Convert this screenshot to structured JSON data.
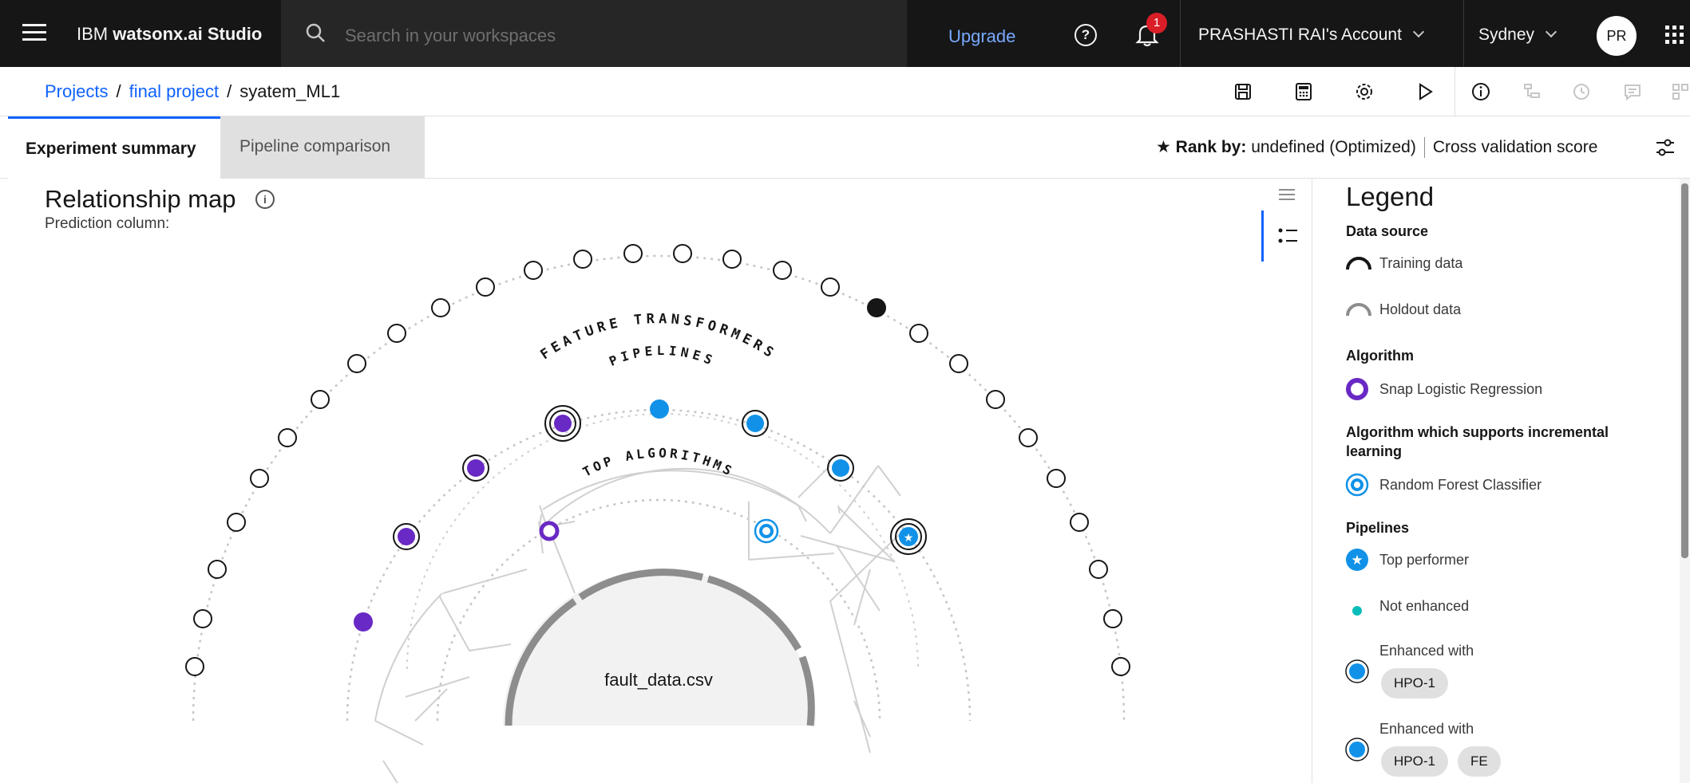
{
  "header": {
    "brand_prefix": "IBM",
    "brand_name": "watsonx.ai Studio",
    "search_placeholder": "Search in your workspaces",
    "upgrade": "Upgrade",
    "notification_count": "1",
    "account": "PRASHASTI RAI's Account",
    "region": "Sydney",
    "avatar_initials": "PR"
  },
  "breadcrumb": {
    "projects": "Projects",
    "project": "final project",
    "current": "syatem_ML1",
    "separator": "/"
  },
  "tabs": {
    "summary": "Experiment summary",
    "comparison": "Pipeline comparison"
  },
  "rank": {
    "label": "Rank by:",
    "value": "undefined (Optimized)",
    "metric": "Cross validation score"
  },
  "map": {
    "title": "Relationship map",
    "prediction_column": "Prediction column:",
    "ring_feature": "FEATURE TRANSFORMERS",
    "ring_pipelines": "PIPELINES",
    "ring_algorithms": "TOP ALGORITHMS",
    "dataset": "fault_data.csv"
  },
  "legend": {
    "title": "Legend",
    "data_source": "Data source",
    "training": "Training data",
    "holdout": "Holdout data",
    "algorithm": "Algorithm",
    "snap_lr": "Snap Logistic Regression",
    "incremental": "Algorithm which supports incremental learning",
    "rf": "Random Forest Classifier",
    "pipelines": "Pipelines",
    "top": "Top performer",
    "not_enhanced": "Not enhanced",
    "enhanced1": "Enhanced with",
    "enhanced2": "Enhanced with",
    "tag_hpo1": "HPO-1",
    "tag_hpo1b": "HPO-1",
    "tag_fe": "FE"
  },
  "colors": {
    "purple": "#6929c4",
    "blue": "#1192e8",
    "dark": "#161616",
    "link": "#0f62fe"
  }
}
